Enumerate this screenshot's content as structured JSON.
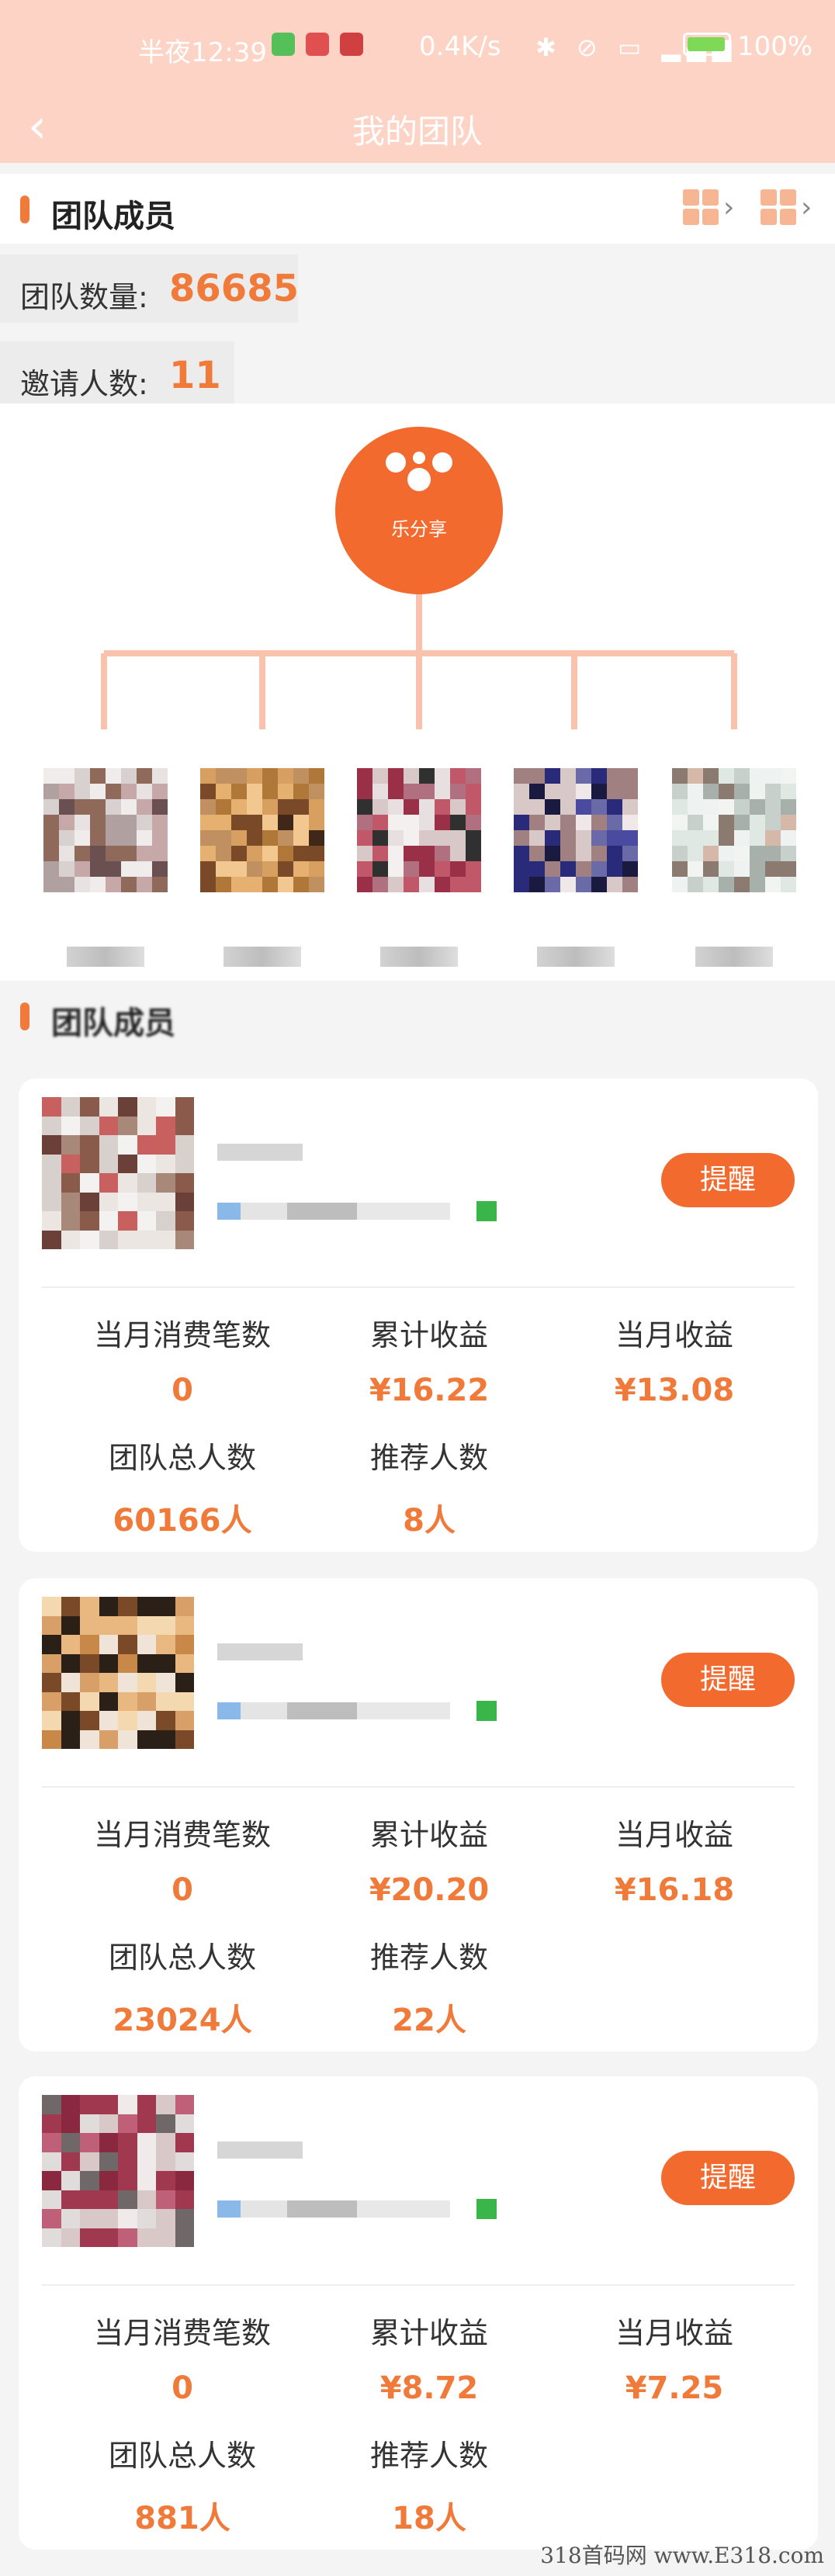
{
  "status_bar": {
    "time": "半夜12:39",
    "speed": "0.4K/s",
    "battery": "100%",
    "app_colors": [
      "#55c05a",
      "#e05050",
      "#d04040"
    ]
  },
  "nav": {
    "back_icon": "chevron-left-icon",
    "title": "我的团队"
  },
  "team_section": {
    "title": "团队成员",
    "qr_icon": "qrcode-icon"
  },
  "stats": {
    "team_count_label": "团队数量:",
    "team_count_value": "86685",
    "invite_label": "邀请人数:",
    "invite_value": "11"
  },
  "brand": {
    "name": "乐分享"
  },
  "members_section": {
    "title": "团队成员"
  },
  "cards": [
    {
      "remind_label": "提醒",
      "metrics": [
        {
          "label": "当月消费笔数",
          "value": "0"
        },
        {
          "label": "累计收益",
          "value": "¥16.22"
        },
        {
          "label": "当月收益",
          "value": "¥13.08"
        },
        {
          "label": "团队总人数",
          "value": "60166人"
        },
        {
          "label": "推荐人数",
          "value": "8人"
        }
      ]
    },
    {
      "remind_label": "提醒",
      "metrics": [
        {
          "label": "当月消费笔数",
          "value": "0"
        },
        {
          "label": "累计收益",
          "value": "¥20.20"
        },
        {
          "label": "当月收益",
          "value": "¥16.18"
        },
        {
          "label": "团队总人数",
          "value": "23024人"
        },
        {
          "label": "推荐人数",
          "value": "22人"
        }
      ]
    },
    {
      "remind_label": "提醒",
      "metrics": [
        {
          "label": "当月消费笔数",
          "value": "0"
        },
        {
          "label": "累计收益",
          "value": "¥8.72"
        },
        {
          "label": "当月收益",
          "value": "¥7.25"
        },
        {
          "label": "团队总人数",
          "value": "881人"
        },
        {
          "label": "推荐人数",
          "value": "18人"
        }
      ]
    }
  ],
  "colors": {
    "accent": "#f07a3a",
    "header": "#fcd3c4",
    "online": "#39b54a"
  },
  "watermark": "318首码网 www.E318.com"
}
